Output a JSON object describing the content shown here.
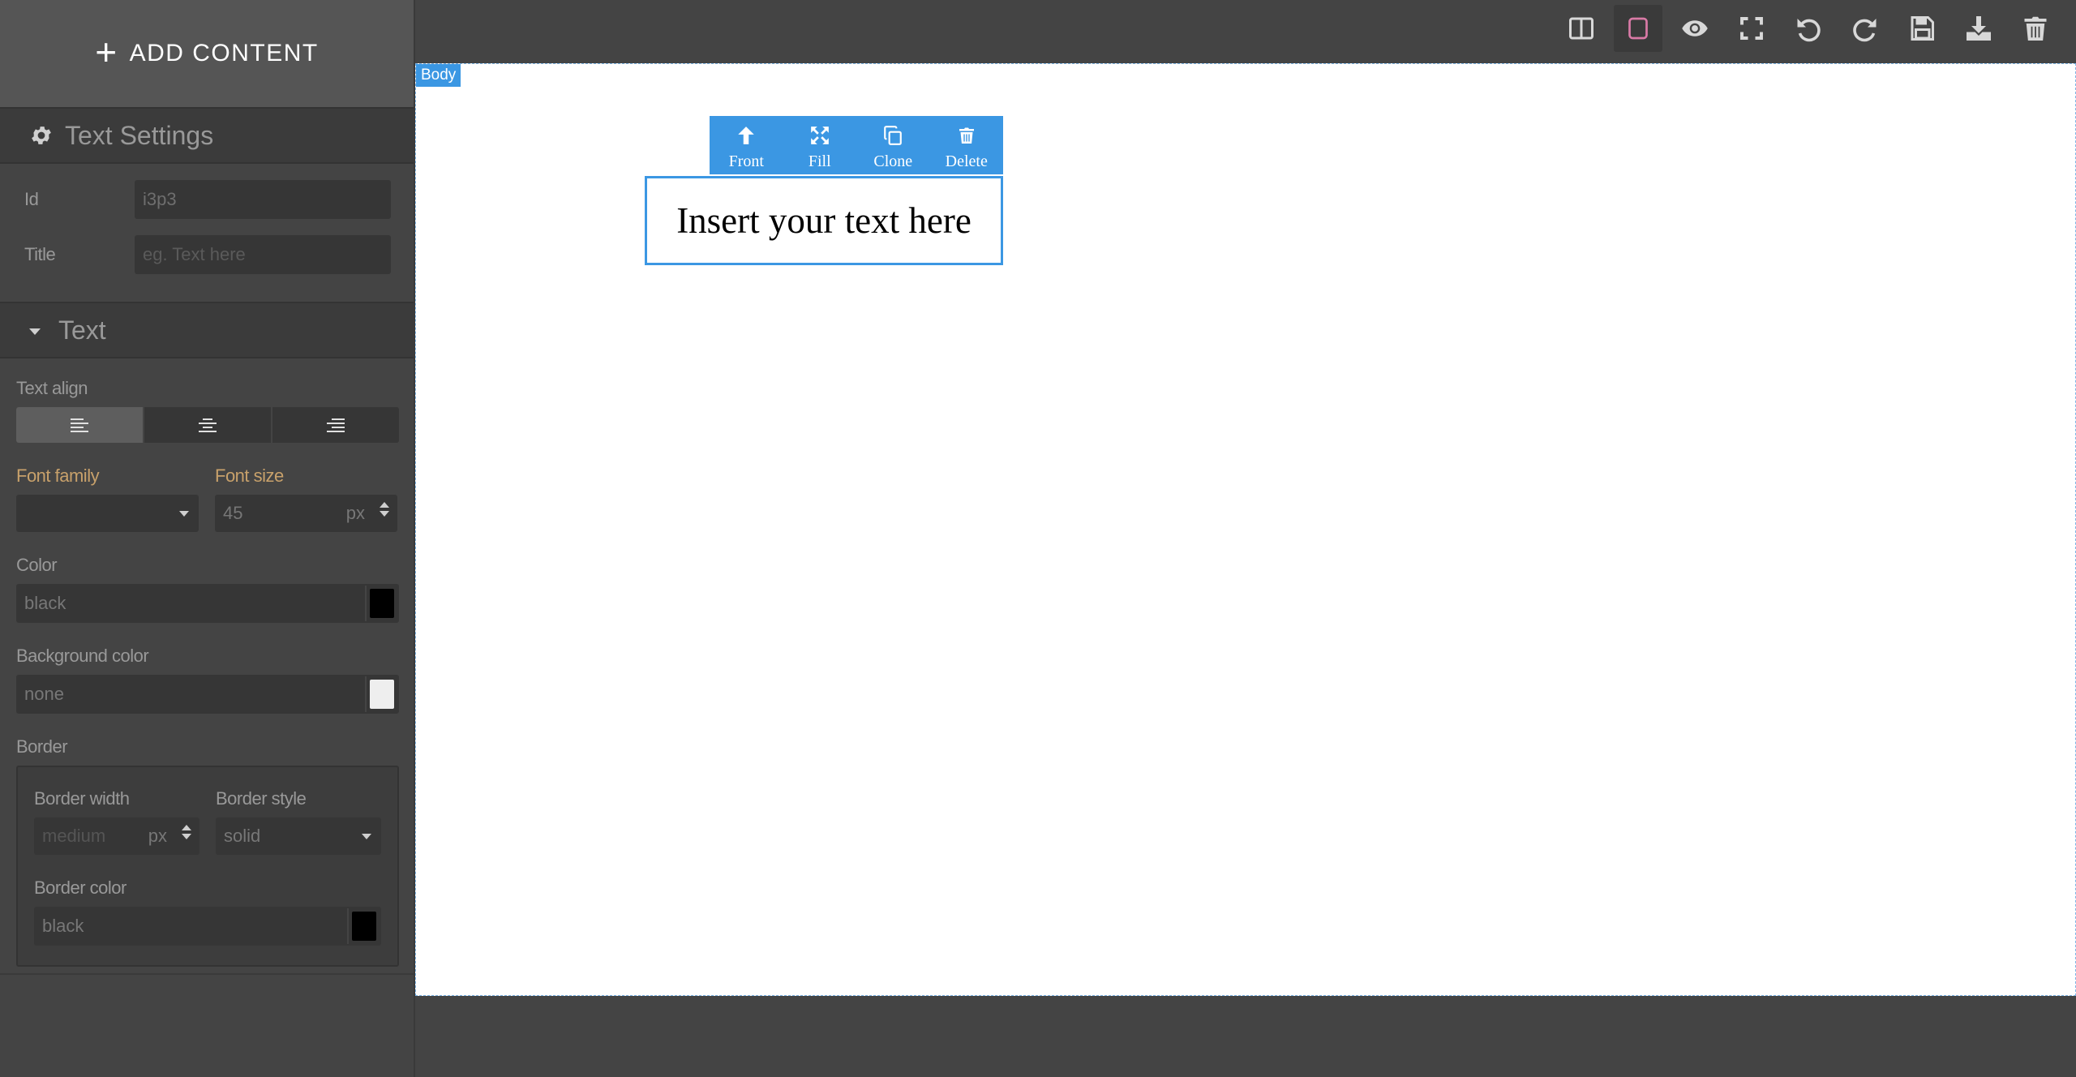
{
  "sidebar": {
    "add_content": "ADD CONTENT",
    "text_settings": {
      "title": "Text Settings",
      "id_label": "Id",
      "id_value": "i3p3",
      "title_label": "Title",
      "title_placeholder": "eg. Text here"
    },
    "text_sector": {
      "title": "Text",
      "text_align": {
        "label": "Text align",
        "options": [
          "left",
          "center",
          "right"
        ],
        "selected": "left"
      },
      "font_family": {
        "label": "Font family",
        "value": ""
      },
      "font_size": {
        "label": "Font size",
        "value": "45",
        "unit": "px"
      },
      "color": {
        "label": "Color",
        "value": "black",
        "swatch": "#000000"
      },
      "background_color": {
        "label": "Background color",
        "value": "none",
        "swatch": "#eeeeee"
      },
      "border": {
        "label": "Border",
        "width": {
          "label": "Border width",
          "placeholder": "medium",
          "unit": "px"
        },
        "style": {
          "label": "Border style",
          "value": "solid"
        },
        "color": {
          "label": "Border color",
          "value": "black",
          "swatch": "#000000"
        }
      }
    }
  },
  "toolbar": {
    "buttons": [
      "layout-panel-icon",
      "sw-visibility-icon",
      "preview-eye-icon",
      "fullscreen-icon",
      "undo-icon",
      "redo-icon",
      "save-icon",
      "export-download-icon",
      "trash-icon"
    ],
    "active": "sw-visibility-icon",
    "active_color": "#d97aa6"
  },
  "canvas": {
    "body_badge": "Body",
    "component_toolbar": {
      "front": "Front",
      "fill": "Fill",
      "clone": "Clone",
      "delete": "Delete"
    },
    "text_component": "Insert your text here"
  },
  "colors": {
    "accent_blue": "#3b97e3",
    "panel_bg": "#444444",
    "label_accent": "#c8a16b"
  }
}
